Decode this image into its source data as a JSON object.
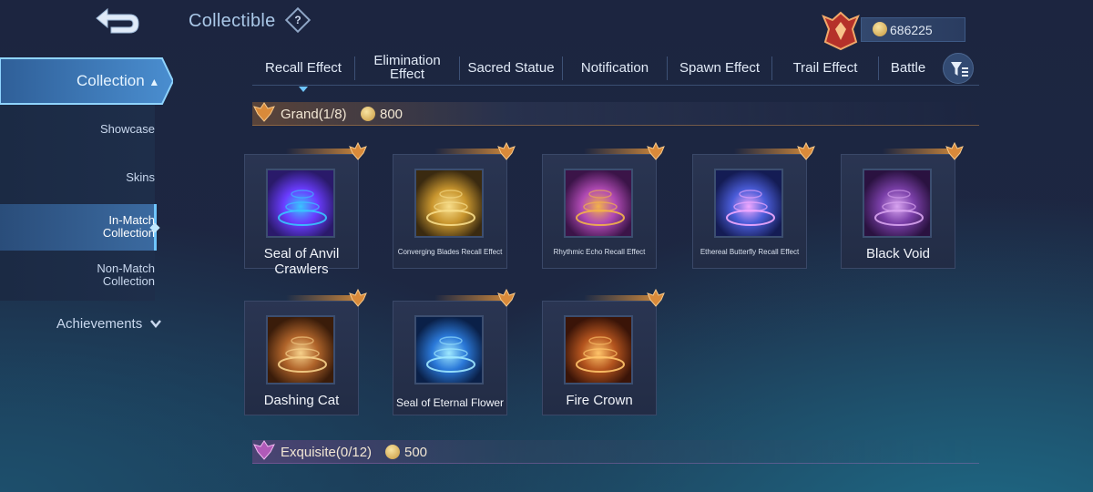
{
  "header": {
    "title": "Collectible",
    "help_symbol": "?",
    "currency_value": "686225"
  },
  "sidebar": {
    "collection_label": "Collection",
    "items": [
      {
        "label": "Showcase"
      },
      {
        "label": "Skins"
      },
      {
        "label": "In-Match Collection",
        "line1": "In-Match",
        "line2": "Collection",
        "active": true
      },
      {
        "label": "Non-Match Collection",
        "line1": "Non-Match",
        "line2": "Collection"
      }
    ],
    "achievements_label": "Achievements"
  },
  "tabs": [
    {
      "label": "Recall Effect",
      "active": true
    },
    {
      "label": "Elimination Effect",
      "line1": "Elimination",
      "line2": "Effect"
    },
    {
      "label": "Sacred Statue"
    },
    {
      "label": "Notification"
    },
    {
      "label": "Spawn Effect"
    },
    {
      "label": "Trail Effect"
    },
    {
      "label": "Battle"
    }
  ],
  "sections": [
    {
      "title": "Grand(1/8)",
      "price": "800"
    },
    {
      "title": "Exquisite(0/12)",
      "price": "500"
    }
  ],
  "items": [
    {
      "name": "Seal of Anvil Crawlers",
      "colors": [
        "#2a1a6a",
        "#6a3cff",
        "#39c4ff"
      ]
    },
    {
      "name": "Converging Blades Recall Effect",
      "colors": [
        "#3a2a10",
        "#c9962e",
        "#f7dd8a"
      ]
    },
    {
      "name": "Rhythmic Echo Recall Effect",
      "colors": [
        "#3b1448",
        "#b04ab4",
        "#f3b24a"
      ]
    },
    {
      "name": "Ethereal Butterfly Recall Effect",
      "colors": [
        "#141c54",
        "#4a5cd8",
        "#f0a8ff"
      ]
    },
    {
      "name": "Black Void",
      "colors": [
        "#2a1240",
        "#7a3fa8",
        "#d8a4f0"
      ]
    },
    {
      "name": "Dashing Cat",
      "colors": [
        "#3a1c0a",
        "#b0642a",
        "#f6d08a"
      ]
    },
    {
      "name": "Seal of Eternal Flower",
      "colors": [
        "#0a2048",
        "#2a78d8",
        "#9ee8ff"
      ]
    },
    {
      "name": "Fire Crown",
      "colors": [
        "#3a1408",
        "#b4541e",
        "#ffc46a"
      ]
    }
  ],
  "colors": {
    "accent": "#6fc6ff",
    "gold": "#c8843a"
  }
}
